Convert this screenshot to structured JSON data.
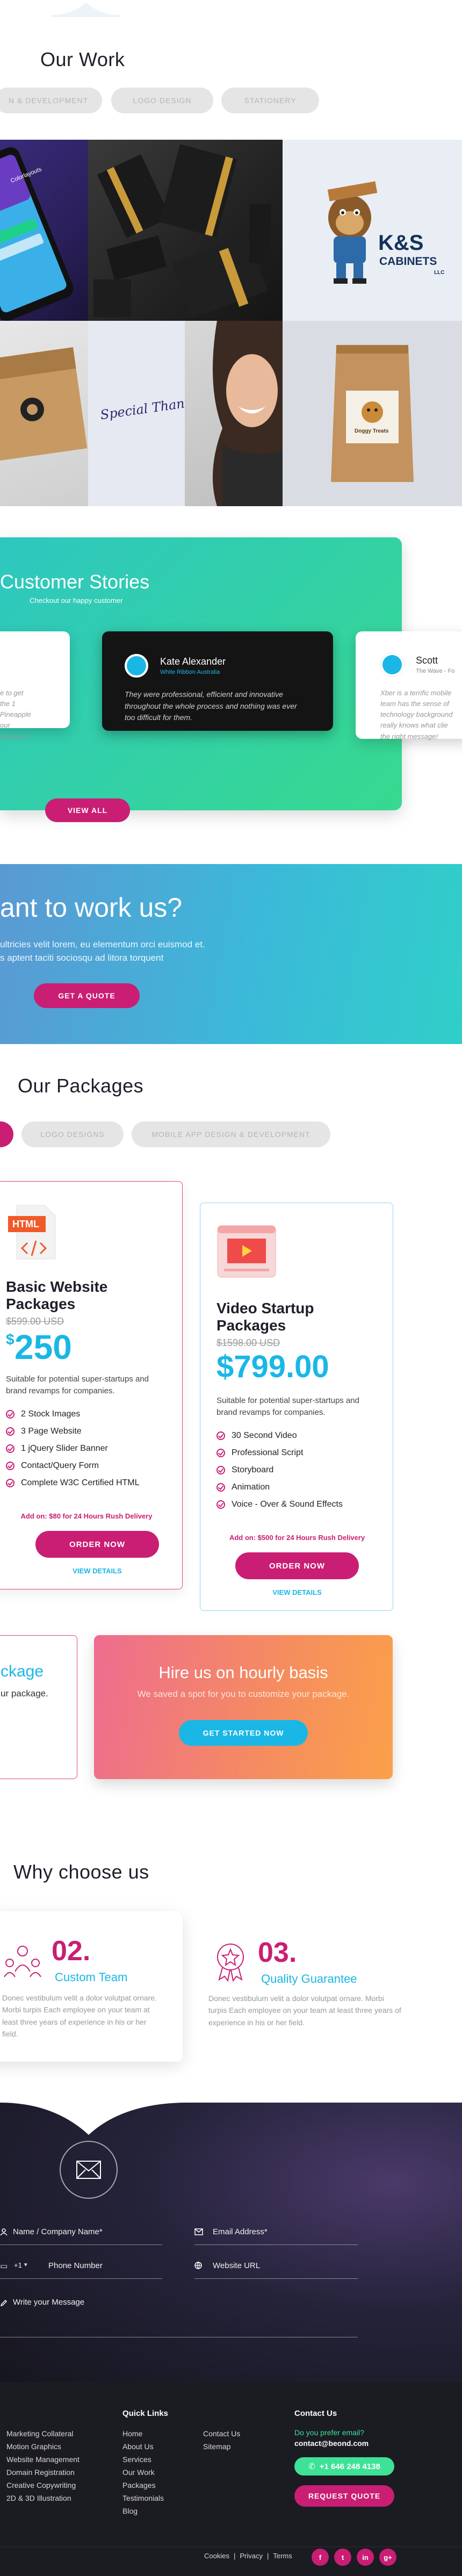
{
  "our_work": {
    "title": "Our Work",
    "filters": [
      "N & DEVELOPMENT",
      "LOGO DESIGN",
      "STATIONERY"
    ],
    "tiles": {
      "phone_text": "Colorlayouts",
      "logo_main": "K&S",
      "logo_sub": "CABINETS",
      "logo_llc": "LLC",
      "note_text": "Special Thanks!",
      "bag_label": "Doggy Treats"
    }
  },
  "stories": {
    "title": "Customer Stories",
    "subtitle": "Checkout our happy customer",
    "left_quote": "e to get the 1 Pineapple our business",
    "center": {
      "name": "Kate Alexander",
      "role": "White Ribbon Australia",
      "quote": "They were professional, efficient and innovative throughout the whole process and nothing was ever too difficult for them."
    },
    "right": {
      "name": "Scott",
      "role": "The Wave - Fo",
      "quote": "Xber is a terrific mobile team has the sense of technology background really knows what clie the right message!"
    },
    "button": "VIEW ALL"
  },
  "cta": {
    "title": "ant to work us?",
    "line1": "ultricies velit lorem, eu elementum orci euismod et.",
    "line2": "s aptent taciti sociosqu ad litora torquent",
    "button": "GET A QUOTE"
  },
  "packages": {
    "title": "Our Packages",
    "filters": [
      "LOGO DESIGNS",
      "MOBILE APP DESIGN & DEVELOPMENT"
    ],
    "website": {
      "badge": "HTML",
      "name": "Basic Website Packages",
      "old_price": "$599.00 USD",
      "currency": "$",
      "price": "250",
      "desc": "Suitable for potential super-startups and brand revamps for companies.",
      "features": [
        "2 Stock Images",
        "3 Page Website",
        "1 jQuery Slider Banner",
        "Contact/Query Form",
        "Complete W3C Certified HTML"
      ],
      "addon": "Add on: $80 for 24 Hours Rush Delivery",
      "button": "ORDER NOW",
      "details": "VIEW DETAILS"
    },
    "video": {
      "name": "Video Startup Packages",
      "old_price": "$1598.00 USD",
      "price": "$799.00",
      "desc": "Suitable for potential super-startups and brand revamps for companies.",
      "features": [
        "30 Second Video",
        "Professional Script",
        "Storyboard",
        "Animation",
        "Voice - Over & Sound Effects"
      ],
      "addon": "Add on: $500 for 24 Hours Rush Delivery",
      "button": "ORDER NOW",
      "details": "VIEW DETAILS"
    },
    "custom_partial_title": "ckage",
    "custom_partial_text": "ur package.",
    "hourly": {
      "title": "Hire us on hourly basis",
      "text": "We saved a spot for you to customize your package.",
      "button": "GET STARTED NOW"
    }
  },
  "why": {
    "title": "Why choose us",
    "items": [
      {
        "num": "02.",
        "title": "Custom Team",
        "text": "Donec vestibulum velit a dolor volutpat ornare. Morbi turpis Each employee on your team at least three years of experience in his or her field."
      },
      {
        "num": "03.",
        "title": "Quality Guarantee",
        "text": "Donec vestibulum velit a dolor volutpat ornare. Morbi turpis Each employee on your team at least three years of experience in his or her field."
      }
    ]
  },
  "contact_form": {
    "name_label": "Name / Company Name*",
    "email_label": "Email Address*",
    "phone_prefix": "+1",
    "phone_label": "Phone Number",
    "website_label": "Website URL",
    "message_label": "Write your Message"
  },
  "footer": {
    "services": [
      "Marketing Collateral",
      "Motion Graphics",
      "Website Management",
      "Domain Registration",
      "Creative Copywriting",
      "2D & 3D Illustration"
    ],
    "quick_links_title": "Quick Links",
    "quick_links_col1": [
      "Home",
      "About Us",
      "Services",
      "Our Work",
      "Packages",
      "Testimonials",
      "Blog"
    ],
    "quick_links_col2": [
      "Contact Us",
      "Sitemap"
    ],
    "contact_title": "Contact Us",
    "email_prompt": "Do you prefer email?",
    "email": "contact@beond.com",
    "phone": "+1 646 248 4138",
    "quote_button": "REQUEST QUOTE",
    "bottom_links": [
      "Cookies",
      "Privacy",
      "Terms"
    ],
    "socials": [
      "f",
      "t",
      "in",
      "g+"
    ]
  },
  "colors": {
    "accent_pink": "#c91e74",
    "accent_blue": "#1ab7e6",
    "teal": "#2ec7c0",
    "green": "#3ee296"
  }
}
